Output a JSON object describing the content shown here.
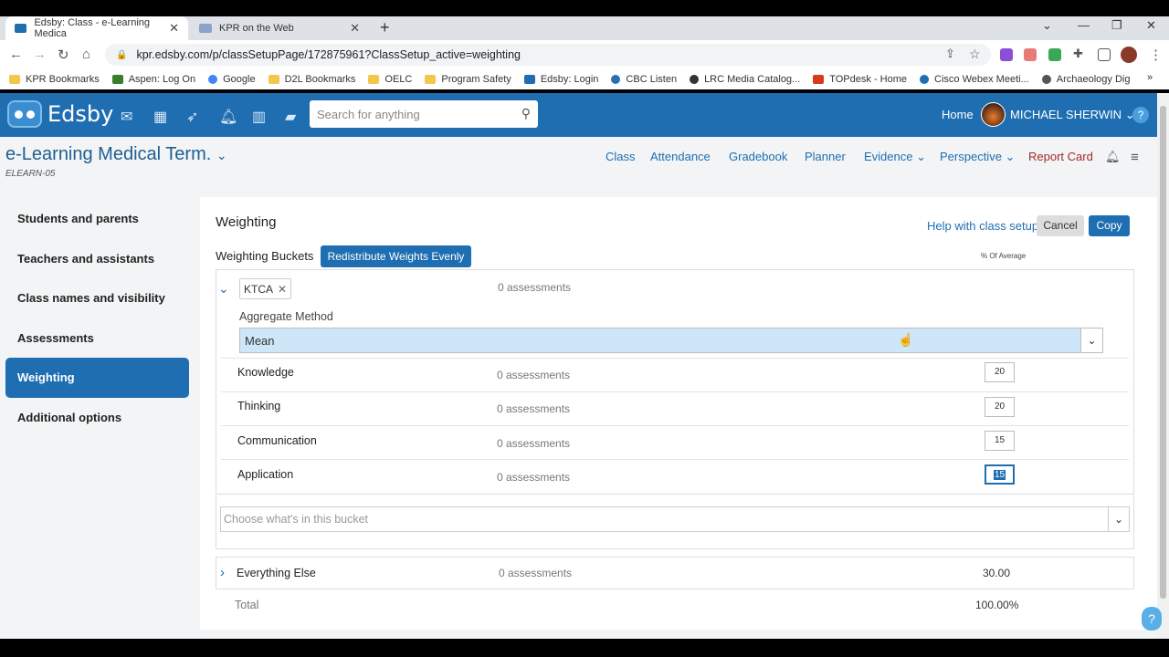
{
  "browser": {
    "tabs": [
      {
        "title": "Edsby: Class - e-Learning Medica",
        "active": true
      },
      {
        "title": "KPR on the Web",
        "active": false
      }
    ],
    "url": "kpr.edsby.com/p/classSetupPage/172875961?ClassSetup_active=weighting",
    "bookmarks": [
      "KPR Bookmarks",
      "Aspen: Log On",
      "Google",
      "D2L Bookmarks",
      "OELC",
      "Program Safety",
      "Edsby: Login",
      "CBC Listen",
      "LRC Media Catalog...",
      "TOPdesk - Home",
      "Cisco Webex Meeti...",
      "Archaeology Dig"
    ],
    "bookmark_colors": [
      "#f3c74b",
      "#3a7d2c",
      "#4285f4",
      "#f3c74b",
      "#f3c74b",
      "#f3c74b",
      "#1f6eb1",
      "#2a6fb0",
      "#333333",
      "#d93a1e",
      "#1f6eb1",
      "#555555"
    ]
  },
  "header": {
    "brand": "Edsby",
    "search_placeholder": "Search for anything",
    "home": "Home",
    "user": "MICHAEL SHERWIN",
    "help": "?"
  },
  "class": {
    "title": "e-Learning Medical Term.",
    "code": "ELEARN-05",
    "nav": [
      "Class",
      "Attendance",
      "Gradebook",
      "Planner",
      "Evidence",
      "Perspective",
      "Report Card"
    ]
  },
  "sidebar": {
    "items": [
      {
        "label": "Students and parents",
        "active": false
      },
      {
        "label": "Teachers and assistants",
        "active": false
      },
      {
        "label": "Class names and visibility",
        "active": false
      },
      {
        "label": "Assessments",
        "active": false
      },
      {
        "label": "Weighting",
        "active": true
      },
      {
        "label": "Additional options",
        "active": false
      }
    ]
  },
  "weighting": {
    "title": "Weighting",
    "help_link": "Help with class setup",
    "cancel": "Cancel",
    "copy": "Copy",
    "buckets_label": "Weighting Buckets",
    "redistribute": "Redistribute Weights Evenly",
    "pct_header": "% Of Average",
    "bucket": {
      "tag": "KTCA",
      "assessments": "0 assessments",
      "aggregate_label": "Aggregate Method",
      "aggregate_value": "Mean",
      "categories": [
        {
          "name": "Knowledge",
          "assessments": "0 assessments",
          "value": "20"
        },
        {
          "name": "Thinking",
          "assessments": "0 assessments",
          "value": "20"
        },
        {
          "name": "Communication",
          "assessments": "0 assessments",
          "value": "15"
        },
        {
          "name": "Application",
          "assessments": "0 assessments",
          "value": "15"
        }
      ],
      "choose_placeholder": "Choose what's in this bucket"
    },
    "everything_else": {
      "label": "Everything Else",
      "assessments": "0 assessments",
      "value": "30.00"
    },
    "total": {
      "label": "Total",
      "value": "100.00%"
    }
  }
}
